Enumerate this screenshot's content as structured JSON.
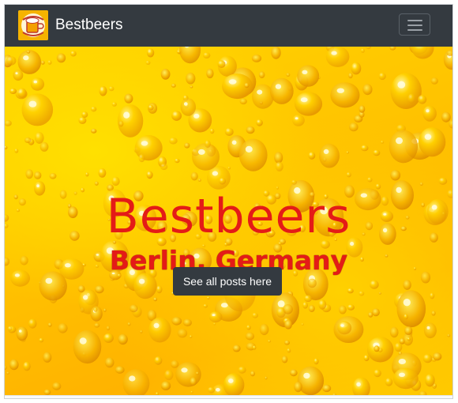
{
  "navbar": {
    "brand": "Bestbeers",
    "logo_icon": "beer-mug-logo-icon",
    "menu_icon": "hamburger-menu-icon",
    "background": "#343a40"
  },
  "hero": {
    "title": "Bestbeers",
    "subtitle": "Berlin, Germany",
    "button_label": "See all posts here",
    "accent": "#e41b17",
    "background_image": "yellow-water-droplets"
  }
}
